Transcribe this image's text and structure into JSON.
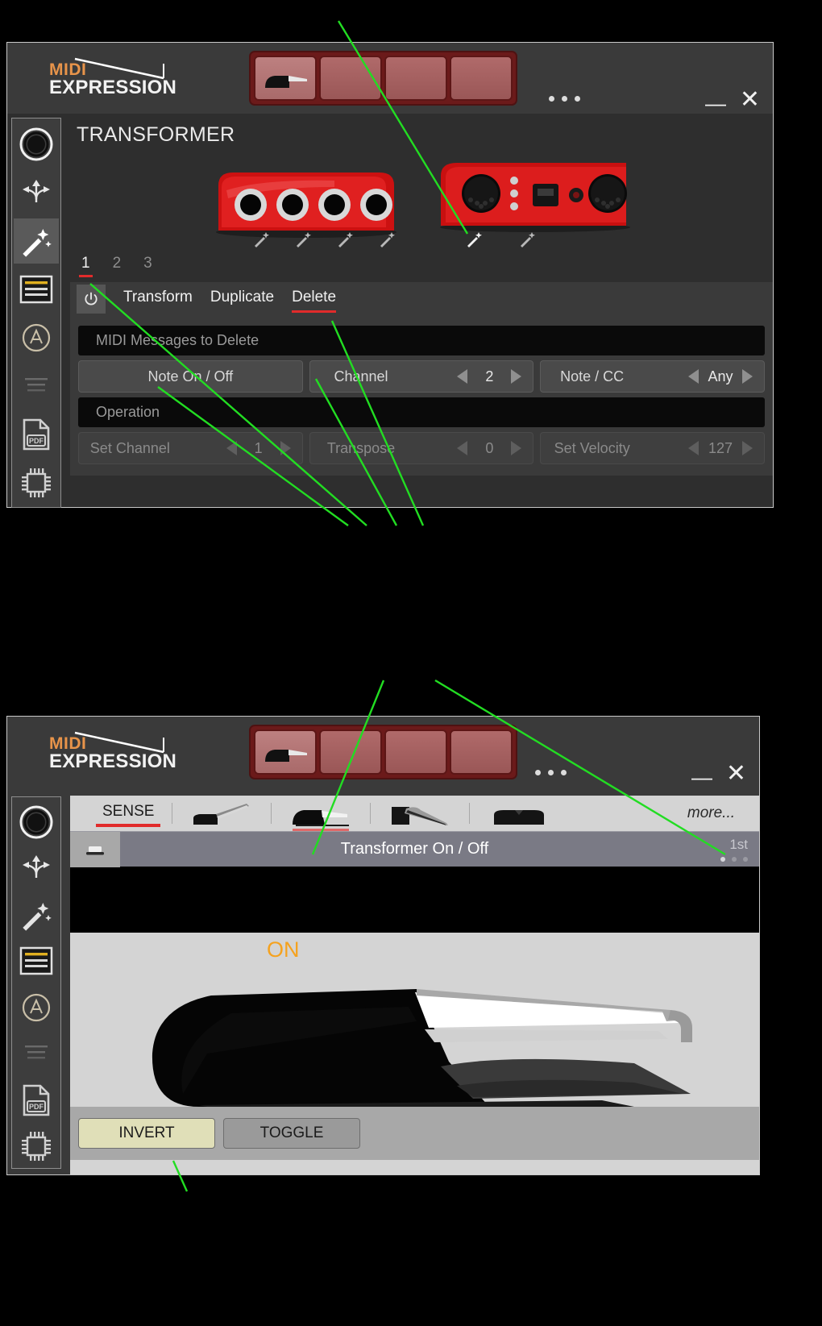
{
  "app": {
    "brand_top": "MIDI",
    "brand_bottom": "EXPRESSION",
    "accent_red": "#e12b2b",
    "accent_orange": "#e8944a"
  },
  "window1": {
    "title": "TRANSFORMER",
    "titlebar": {
      "menu_dots": "···",
      "minimize": "—",
      "close": "✕"
    },
    "rail": [
      {
        "name": "jack-icon",
        "label": "Jack"
      },
      {
        "name": "routing-icon",
        "label": "Routing"
      },
      {
        "name": "magic-wand-icon",
        "label": "Transformer",
        "selected": true
      },
      {
        "name": "list-icon",
        "label": "Presets"
      },
      {
        "name": "auto-icon",
        "label": "Auto"
      },
      {
        "name": "lines-faded-icon",
        "label": "Log"
      },
      {
        "name": "pdf-icon",
        "label": "PDF"
      },
      {
        "name": "chip-icon",
        "label": "Firmware"
      }
    ],
    "number_tabs": [
      {
        "label": "1",
        "active": true
      },
      {
        "label": "2",
        "active": false
      },
      {
        "label": "3",
        "active": false
      }
    ],
    "mode_tabs": [
      {
        "label": "Transform",
        "active": false
      },
      {
        "label": "Duplicate",
        "active": false
      },
      {
        "label": "Delete",
        "active": true
      }
    ],
    "power_icon": "power-icon",
    "section1": {
      "header": "MIDI Messages to Delete"
    },
    "row1": [
      {
        "name": "message-type-select",
        "label": "Note On / Off",
        "value": null,
        "disabled": false
      },
      {
        "name": "channel-stepper",
        "label": "Channel",
        "value": "2",
        "disabled": false
      },
      {
        "name": "note-cc-stepper",
        "label": "Note / CC",
        "value": "Any",
        "disabled": false
      }
    ],
    "section2": {
      "header": "Operation"
    },
    "row2": [
      {
        "name": "set-channel-stepper",
        "label": "Set Channel",
        "value": "1",
        "disabled": true
      },
      {
        "name": "transpose-stepper",
        "label": "Transpose",
        "value": "0",
        "disabled": true
      },
      {
        "name": "set-velocity-stepper",
        "label": "Set Velocity",
        "value": "127",
        "disabled": true
      }
    ]
  },
  "window2": {
    "titlebar": {
      "menu_dots": "···",
      "minimize": "—",
      "close": "✕"
    },
    "sense_tab": {
      "label": "SENSE",
      "active": true
    },
    "pedal_icons": [
      {
        "name": "pedal-icon-sustain",
        "selected": false
      },
      {
        "name": "pedal-icon-expression",
        "selected": true
      },
      {
        "name": "pedal-icon-swell",
        "selected": false
      },
      {
        "name": "pedal-icon-footswitch",
        "selected": false
      }
    ],
    "more_label": "more...",
    "strip": {
      "title": "Transformer On / Off",
      "ordinal": "1st",
      "switch_icon": "switch-icon"
    },
    "page_dots": [
      {
        "active": true
      },
      {
        "active": false
      },
      {
        "active": false
      }
    ],
    "pedal_state_label": "ON",
    "buttons": [
      {
        "name": "invert-button",
        "label": "INVERT",
        "active": true
      },
      {
        "name": "toggle-button",
        "label": "TOGGLE",
        "active": false
      }
    ]
  }
}
